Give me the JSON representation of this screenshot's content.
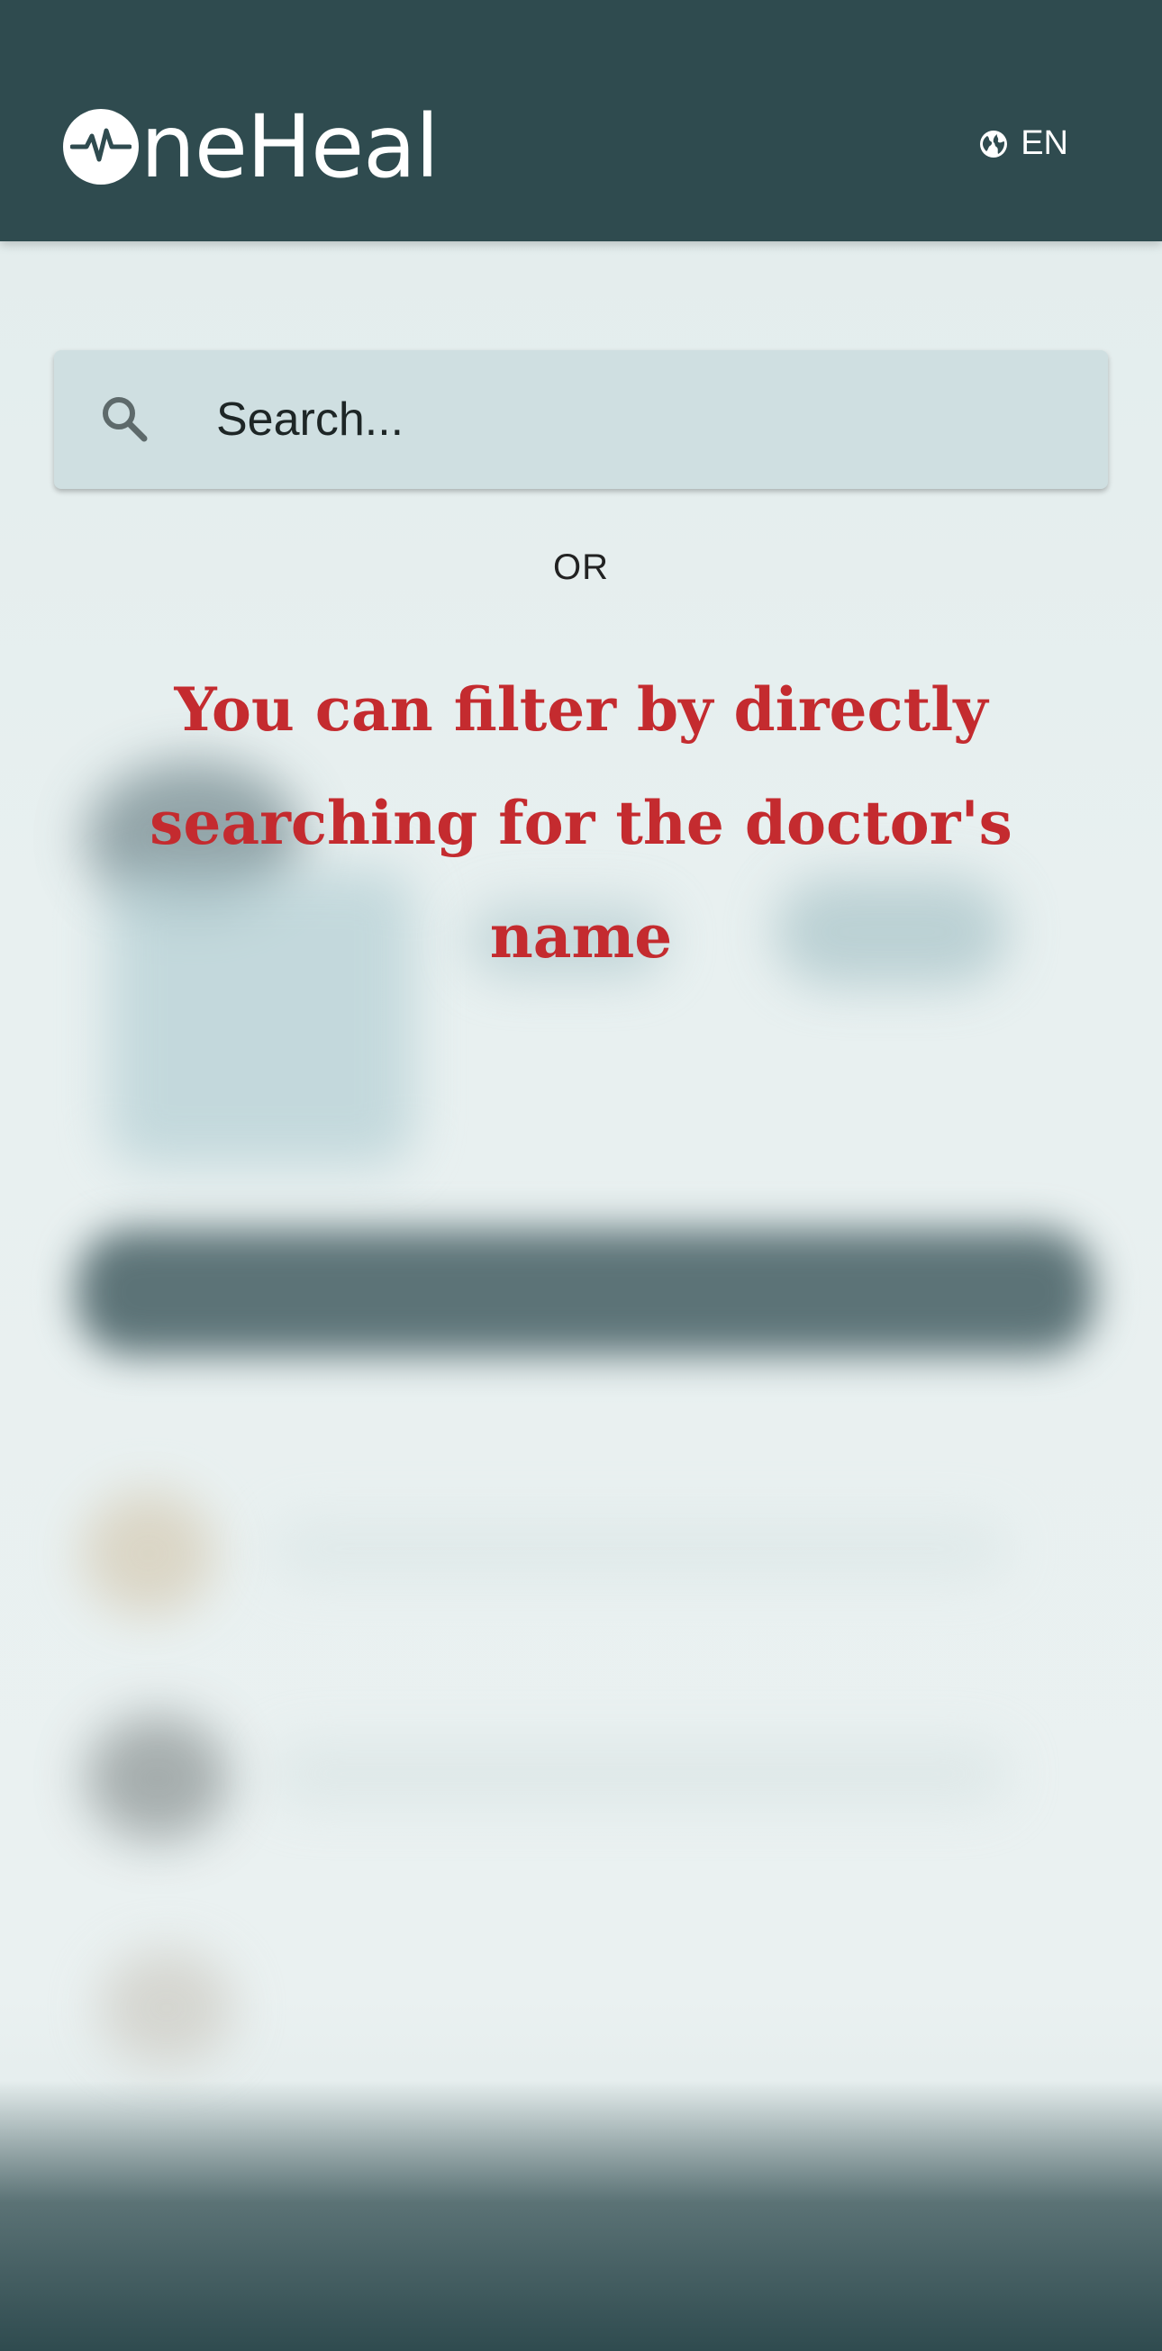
{
  "header": {
    "logo_text": "neHeal",
    "language": "EN",
    "language_icon": "globe-icon"
  },
  "search": {
    "placeholder": "Search...",
    "icon": "search-icon"
  },
  "divider_text": "OR",
  "hint": {
    "line1": "You can filter by directly",
    "line2": "searching for the doctor's name"
  },
  "colors": {
    "header_bg": "#2f4b4f",
    "search_bg": "#cfdfe1",
    "hint_text": "#c42b2f"
  }
}
